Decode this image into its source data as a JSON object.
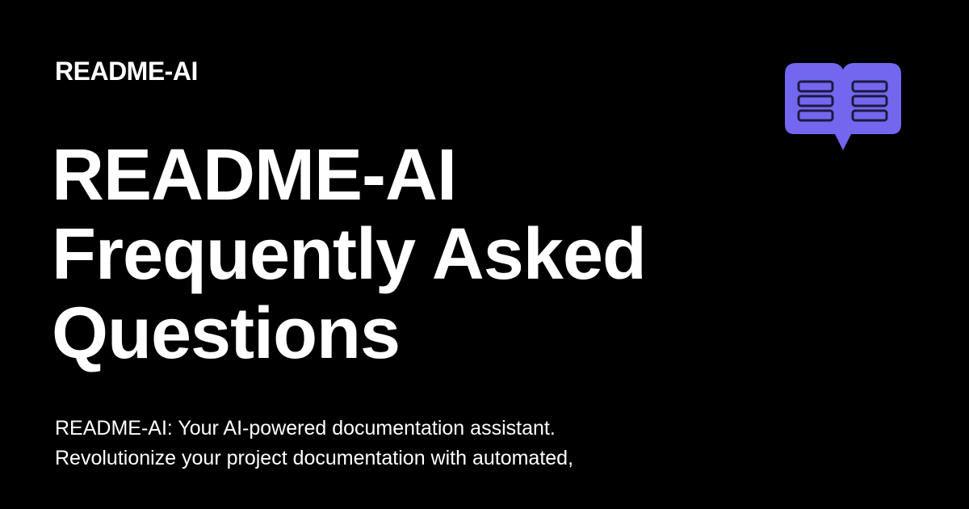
{
  "site_name": "README-AI",
  "title_lines": [
    "README-AI",
    "Frequently Asked",
    "Questions"
  ],
  "description_lines": [
    "README-AI: Your AI-powered documentation assistant.",
    "Revolutionize your project documentation with automated,"
  ],
  "logo_icon": "book-icon",
  "colors": {
    "background": "#000000",
    "text": "#ffffff",
    "logo_fill": "#7367f0",
    "logo_detail": "#1e1a3d"
  }
}
